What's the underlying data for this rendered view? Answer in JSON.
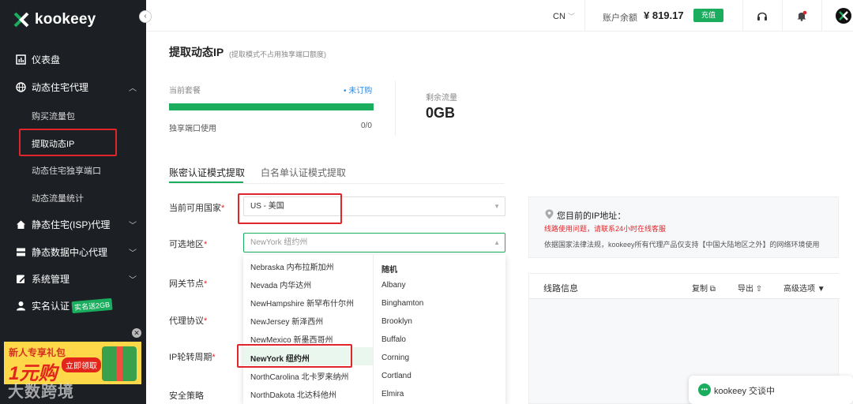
{
  "sidebar": {
    "logo": "kookeey",
    "collapse_icon": "chevron-left-icon",
    "items": [
      {
        "label": "仪表盘",
        "icon": "dashboard-icon"
      },
      {
        "label": "动态住宅代理",
        "icon": "globe-icon"
      },
      {
        "label": "静态住宅(ISP)代理",
        "icon": "home-icon"
      },
      {
        "label": "静态数据中心代理",
        "icon": "server-icon"
      },
      {
        "label": "系统管理",
        "icon": "edit-icon"
      },
      {
        "label": "实名认证",
        "icon": "user-icon",
        "badge": "实名送2GB"
      }
    ],
    "sub_items": [
      "购买流量包",
      "提取动态IP",
      "动态住宅独享端口",
      "动态流量统计"
    ],
    "promo": {
      "line1": "新人专享礼包",
      "line2": "1元购",
      "cta": "立即领取"
    },
    "watermark": "大数跨境"
  },
  "topbar": {
    "lang": "CN",
    "balance_label": "账户余额",
    "balance_value": "¥ 819.17",
    "recharge_label": "充值"
  },
  "main": {
    "title": "提取动态IP",
    "subtitle": "(提取模式不占用独享端口额度)",
    "package_label": "当前套餐",
    "package_status": "• 未订购",
    "progress": 1.0,
    "port_label": "独享端口使用",
    "port_value": "0/0",
    "traffic_label": "剩余流量",
    "traffic_value": "0GB",
    "tabs": [
      "账密认证模式提取",
      "白名单认证模式提取"
    ],
    "form": {
      "country_label": "当前可用国家",
      "country_value": "US - 美国",
      "region_label": "可选地区",
      "region_value": "NewYork 纽约州",
      "gateway_label": "网关节点",
      "protocol_label": "代理协议",
      "rotation_label": "IP轮转周期",
      "security_label": "安全策略"
    },
    "dropdown": {
      "regions": [
        "Nebraska 内布拉斯加州",
        "Nevada 内华达州",
        "NewHampshire 新罕布什尔州",
        "NewJersey 新泽西州",
        "NewMexico 新墨西哥州",
        "NewYork 纽约州",
        "NorthCarolina 北卡罗来纳州",
        "NorthDakota 北达科他州"
      ],
      "cities": [
        "随机",
        "Albany",
        "Binghamton",
        "Brooklyn",
        "Buffalo",
        "Corning",
        "Cortland",
        "Elmira"
      ]
    },
    "ip_card": {
      "title": "您目前的IP地址：",
      "warning": "线路使用问题，请联系24小时在线客服",
      "note": "依据国家法律法规，kookeey所有代理产品仅支持【中国大陆地区之外】的网络环境使用"
    },
    "line_card": {
      "title": "线路信息",
      "copy": "复制",
      "export": "导出",
      "advanced": "高级选项"
    }
  },
  "chat": {
    "label": "kookeey 交谈中"
  }
}
